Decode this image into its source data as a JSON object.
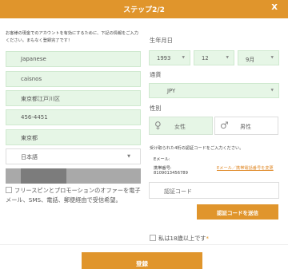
{
  "header": {
    "title": "ステップ2/2",
    "close_label": "X"
  },
  "intro_text": "お客様の現金でのアカウントを有効にするために、下記の情報をご入力ください。まもなく登録完了です！",
  "fields": {
    "country": "Japanese",
    "name": "caisnos",
    "address": "東京都江戸川区",
    "postcode": "456-4451",
    "prefecture": "東京都",
    "language": "日本語"
  },
  "promo_text": "フリースピンとプロモーションのオファーを電子メール、SMS、電話、郵便経由で受信希望。",
  "birthdate": {
    "label": "生年月日",
    "year": "1993",
    "month": "12",
    "day": "9月"
  },
  "currency": {
    "label": "通貨",
    "value": "JPY"
  },
  "gender": {
    "label": "性別",
    "female": "女性",
    "male": "男性"
  },
  "verification": {
    "instruction": "受け取られた4桁の認証コードをご入力ください。",
    "email_label": "Eメール:",
    "phone_label": "携帯番号:",
    "phone_value": "8109013456789",
    "change_link": "Eメール／携帯電話番号を変更",
    "code_placeholder": "認証コード",
    "send_button": "認証コードを送信"
  },
  "age_confirm": "私は18歳以上です",
  "age_required_mark": "*",
  "register_button": "登録",
  "colors": {
    "accent": "#e0952c",
    "field_fill": "#e6f6e6",
    "field_border": "#cfe9cf"
  },
  "icons": {
    "female": "venus-icon",
    "male": "mars-icon"
  }
}
